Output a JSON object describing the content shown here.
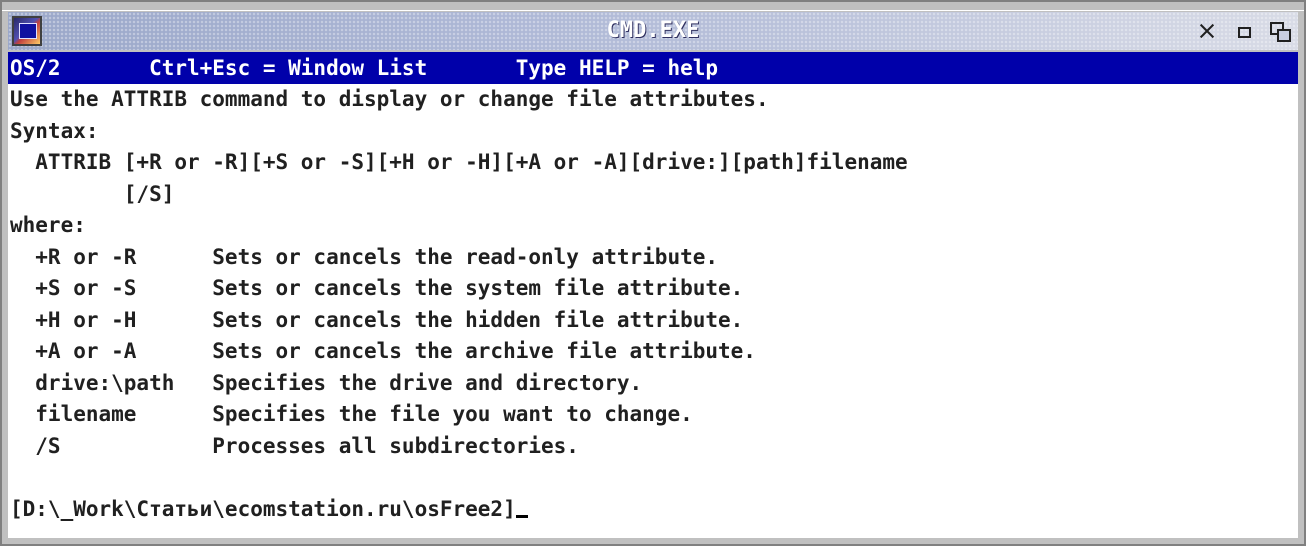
{
  "window": {
    "title": "CMD.EXE"
  },
  "console": {
    "status_line": "OS/2       Ctrl+Esc = Window List       Type HELP = help",
    "lines": [
      "Use the ATTRIB command to display or change file attributes.",
      "Syntax:",
      "  ATTRIB [+R or -R][+S or -S][+H or -H][+A or -A][drive:][path]filename",
      "         [/S]",
      "where:",
      "  +R or -R      Sets or cancels the read-only attribute.",
      "  +S or -S      Sets or cancels the system file attribute.",
      "  +H or -H      Sets or cancels the hidden file attribute.",
      "  +A or -A      Sets or cancels the archive file attribute.",
      "  drive:\\path   Specifies the drive and directory.",
      "  filename      Specifies the file you want to change.",
      "  /S            Processes all subdirectories.",
      ""
    ],
    "prompt": "[D:\\_Work\\Статьи\\ecomstation.ru\\osFree2]"
  },
  "icons": {
    "system_menu": "window-system-menu-icon",
    "close": "close-icon",
    "minimize": "minimize-icon",
    "restore": "restore-icon"
  },
  "colors": {
    "status_bar_bg": "#0000aa",
    "status_bar_fg": "#ffffff",
    "console_bg": "#ffffff",
    "console_fg": "#202020"
  }
}
